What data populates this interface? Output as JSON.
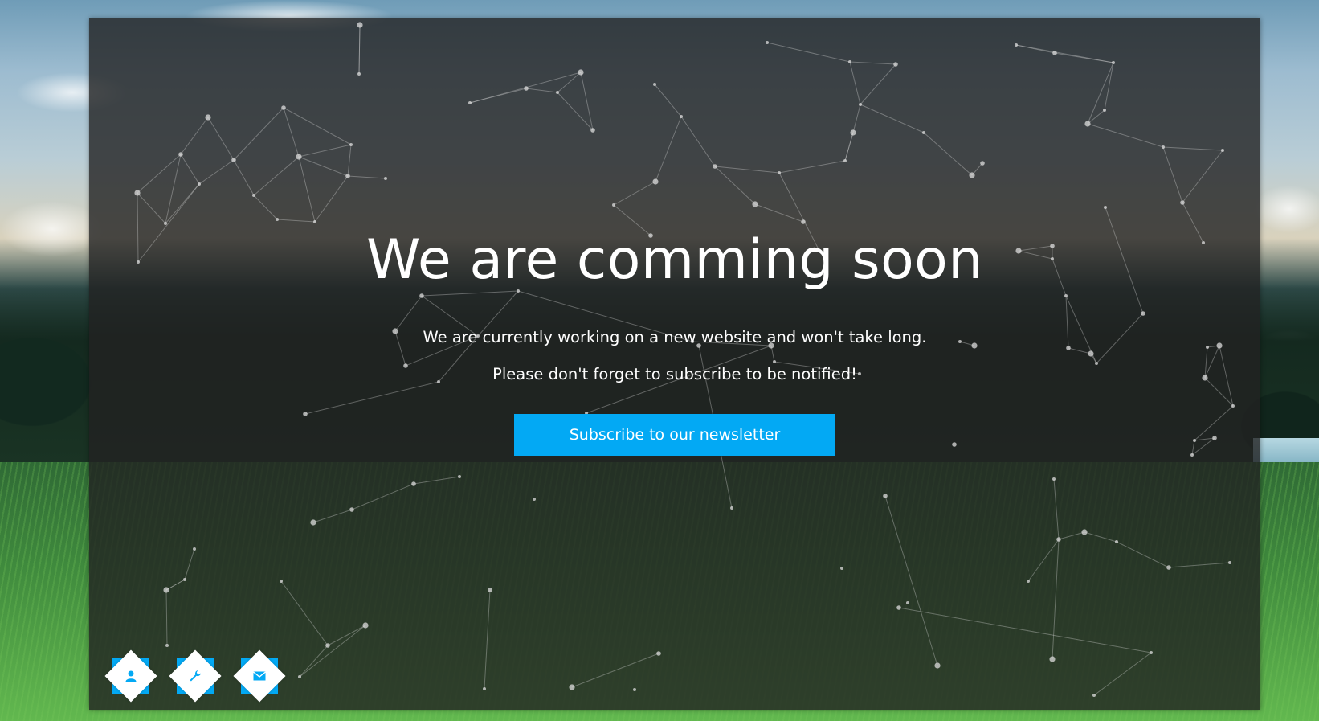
{
  "hero": {
    "title": "We are comming soon",
    "subtitle_line1": "We are currently working on a new website and won't take long.",
    "subtitle_line2": "Please don't forget to subscribe to be notified!",
    "subscribe_label": "Subscribe to our newsletter"
  },
  "social": {
    "items": [
      {
        "icon": "user-icon"
      },
      {
        "icon": "wrench-icon"
      },
      {
        "icon": "envelope-icon"
      }
    ]
  },
  "colors": {
    "accent": "#03a9f4",
    "panel": "#222222",
    "text": "#ffffff"
  }
}
